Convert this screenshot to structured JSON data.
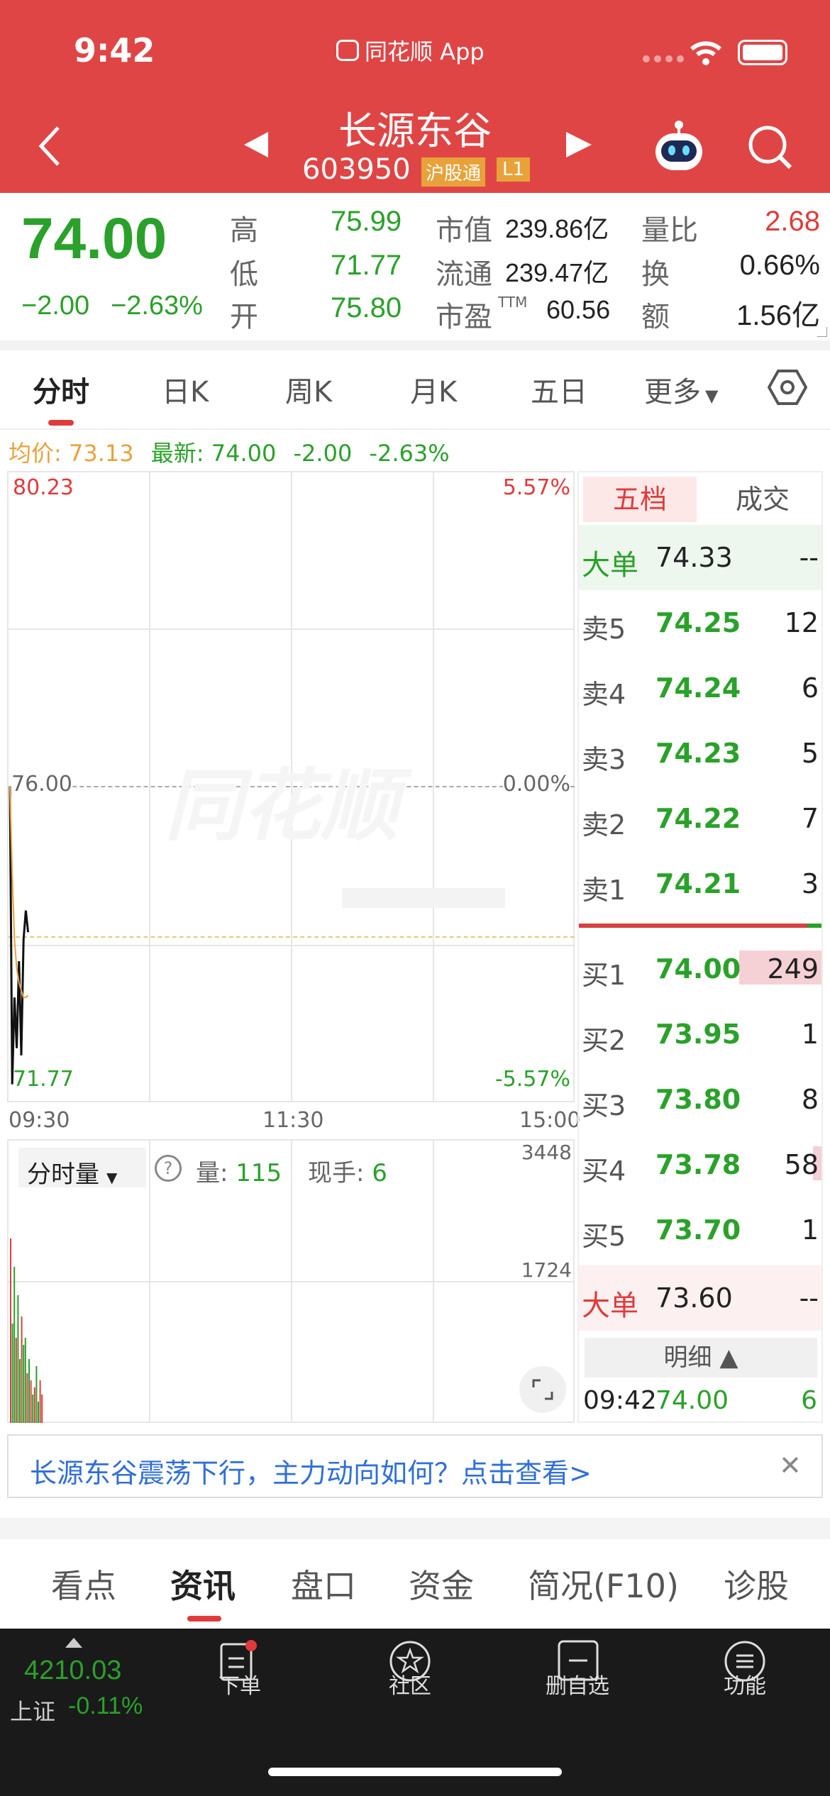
{
  "status_bar": {
    "time": "9:42",
    "app_name": "同花顺 App"
  },
  "stock": {
    "name": "长源东谷",
    "code": "603950",
    "badge_hk": "沪股通",
    "badge_level": "L1"
  },
  "quote": {
    "price": "74.00",
    "change": "−2.00",
    "change_pct": "−2.63%",
    "high_label": "高",
    "high": "75.99",
    "low_label": "低",
    "low": "71.77",
    "open_label": "开",
    "open": "75.80",
    "mktcap_label": "市值",
    "mktcap": "239.86亿",
    "float_label": "流通",
    "float": "239.47亿",
    "pe_label": "市盈",
    "pe_sup": "TTM",
    "pe": "60.56",
    "volratio_label": "量比",
    "volratio": "2.68",
    "turnover_label": "换",
    "turnover": "0.66%",
    "amount_label": "额",
    "amount": "1.56亿"
  },
  "chart_tabs": [
    "分时",
    "日K",
    "周K",
    "月K",
    "五日",
    "更多"
  ],
  "info_line": {
    "avg_label": "均价:",
    "avg": "73.13",
    "latest_label": "最新:",
    "latest": "74.00",
    "change": "-2.00",
    "change_pct": "-2.63%"
  },
  "chart": {
    "y_top": "80.23",
    "y_mid": "76.00",
    "y_bottom": "71.77",
    "pct_top": "5.57%",
    "pct_mid": "0.00%",
    "pct_bottom": "-5.57%",
    "x_start": "09:30",
    "x_mid": "11:30",
    "x_end": "15:00",
    "watermark": "同花顺"
  },
  "chart_data": {
    "type": "line",
    "series": [
      {
        "values": [
          76.0,
          71.9,
          73.1,
          72.4,
          73.6,
          72.3,
          73.9,
          74.3,
          74.0
        ]
      },
      {
        "values": [
          76.0,
          74.8,
          73.9,
          73.5,
          73.3,
          73.2,
          73.1,
          73.1,
          73.13
        ]
      }
    ],
    "ylim": [
      71.77,
      80.23
    ],
    "volume": {
      "ylim": [
        0,
        3448
      ],
      "max_label": "3448",
      "mid_label": "1724"
    }
  },
  "volume_panel": {
    "selector": "分时量",
    "help": "?",
    "vol_label": "量:",
    "vol": "115",
    "hand_label": "现手:",
    "hand": "6"
  },
  "orderbook": {
    "tab_active": "五档",
    "tab_other": "成交",
    "big_sell": {
      "label": "大单",
      "price": "74.33",
      "vol": "--"
    },
    "asks": [
      {
        "label": "卖5",
        "price": "74.25",
        "vol": "12"
      },
      {
        "label": "卖4",
        "price": "74.24",
        "vol": "6"
      },
      {
        "label": "卖3",
        "price": "74.23",
        "vol": "5"
      },
      {
        "label": "卖2",
        "price": "74.22",
        "vol": "7"
      },
      {
        "label": "卖1",
        "price": "74.21",
        "vol": "3"
      }
    ],
    "bids": [
      {
        "label": "买1",
        "price": "74.00",
        "vol": "249"
      },
      {
        "label": "买2",
        "price": "73.95",
        "vol": "1"
      },
      {
        "label": "买3",
        "price": "73.80",
        "vol": "8"
      },
      {
        "label": "买4",
        "price": "73.78",
        "vol": "58"
      },
      {
        "label": "买5",
        "price": "73.70",
        "vol": "1"
      }
    ],
    "big_buy": {
      "label": "大单",
      "price": "73.60",
      "vol": "--"
    },
    "detail_label": "明细 ▲",
    "tick": {
      "time": "09:42",
      "price": "74.00",
      "vol": "6"
    }
  },
  "banner": {
    "text": "长源东谷震荡下行，主力动向如何？点击查看>"
  },
  "bottom_tabs": [
    "看点",
    "资讯",
    "盘口",
    "资金",
    "简况(F10)",
    "诊股"
  ],
  "index": {
    "value": "4210.03",
    "name": "上证",
    "change": "-0.11%"
  },
  "nav": [
    {
      "label": "下单",
      "icon": "order-icon"
    },
    {
      "label": "社区",
      "icon": "community-icon"
    },
    {
      "label": "删自选",
      "icon": "remove-watch-icon"
    },
    {
      "label": "功能",
      "icon": "menu-icon"
    }
  ]
}
